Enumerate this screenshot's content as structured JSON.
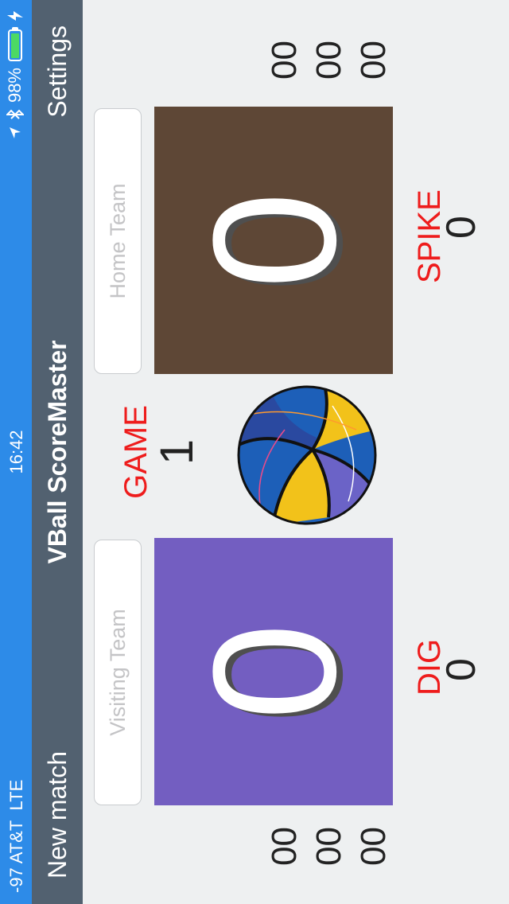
{
  "status": {
    "signal": "-97",
    "carrier": "AT&T",
    "network": "LTE",
    "time": "16:42",
    "battery": "98%",
    "battery_level": 0.98
  },
  "nav": {
    "left_label": "New match",
    "title": "VBall ScoreMaster",
    "right_label": "Settings"
  },
  "visiting": {
    "placeholder": "Visiting Team",
    "score": "0",
    "sets": [
      "00",
      "00",
      "00"
    ],
    "color": "#735ec1"
  },
  "home": {
    "placeholder": "Home Team",
    "score": "0",
    "sets": [
      "00",
      "00",
      "00"
    ],
    "color": "#5e4736"
  },
  "game": {
    "label": "GAME",
    "number": "1"
  },
  "stats": {
    "left_label": "DIG",
    "left_value": "0",
    "right_label": "SPIKE",
    "right_value": "0"
  },
  "colors": {
    "status_bar": "#2d8be8",
    "nav_bar": "#526170",
    "accent_red": "#ee1c1c",
    "battery_fill": "#4cd964"
  }
}
